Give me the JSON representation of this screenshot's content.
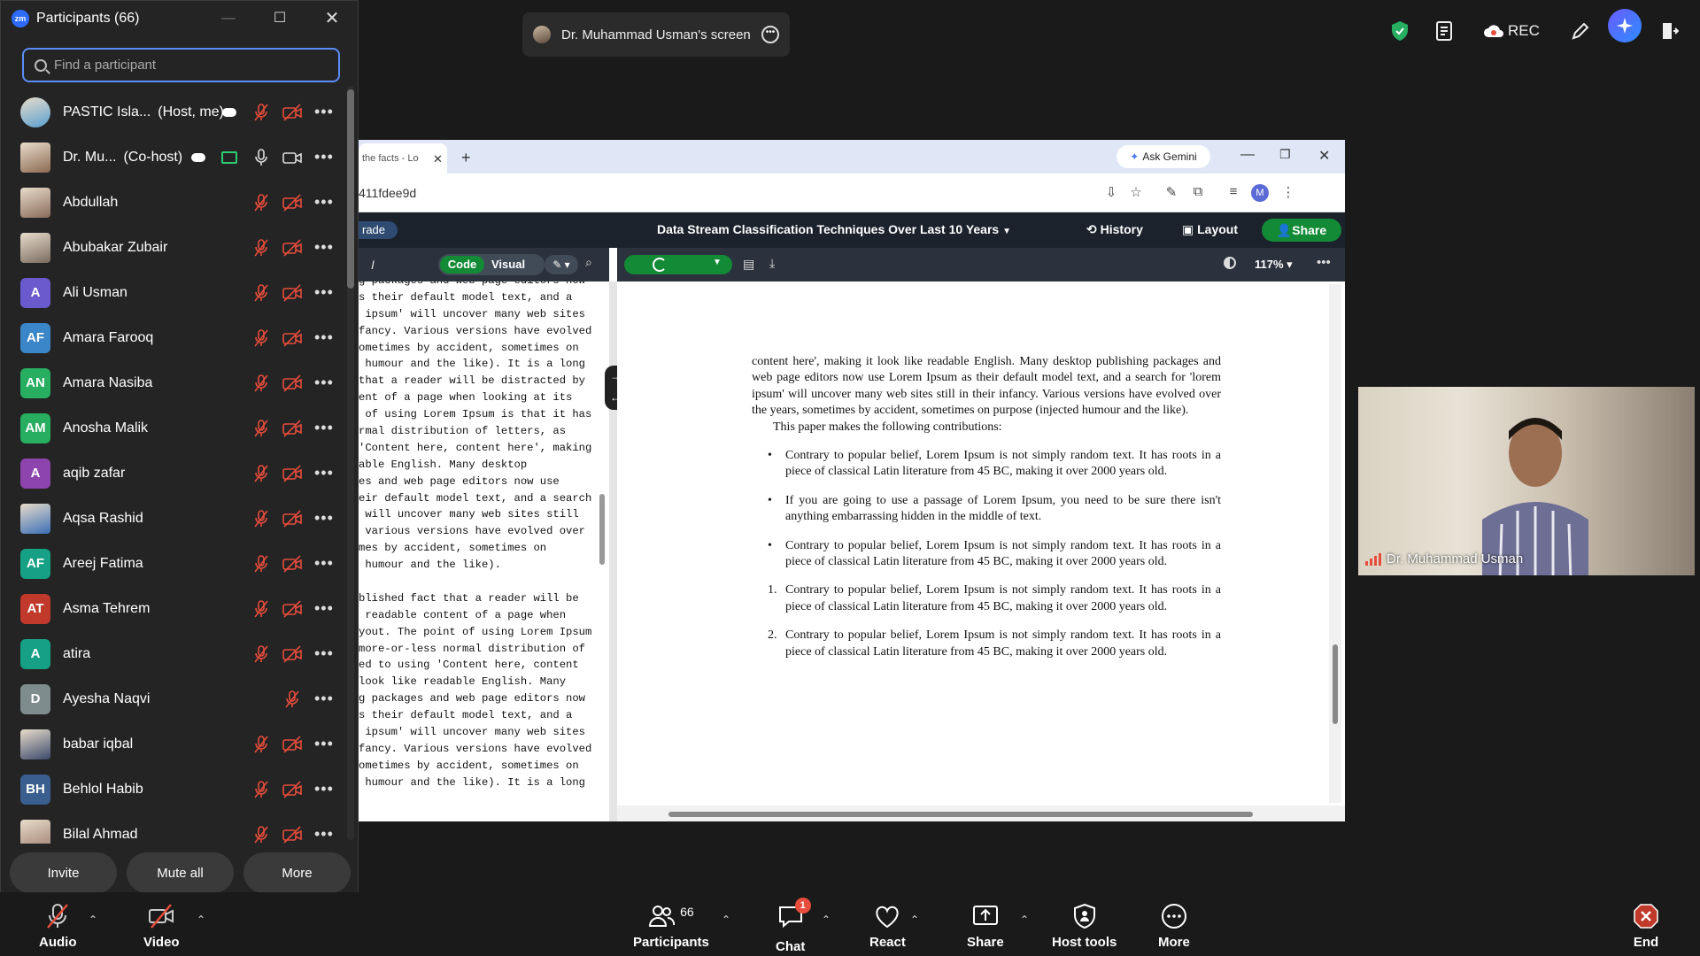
{
  "participants_panel": {
    "logo_text": "zm",
    "title": "Participants (66)",
    "search_placeholder": "Find a participant",
    "participants": [
      {
        "name": "PASTIC Isla...",
        "role": "(Host, me)",
        "avatar": "photo",
        "color": "#5aa0d0"
      },
      {
        "name": "Dr. Mu...",
        "role": "(Co-host)",
        "avatar": "photo",
        "color": "#8c6a52"
      },
      {
        "name": "Abdullah",
        "role": "",
        "avatar": "photo",
        "color": "#8a6b5a"
      },
      {
        "name": "Abubakar Zubair",
        "role": "",
        "avatar": "photo",
        "color": "#7b6b60"
      },
      {
        "name": "Ali Usman",
        "role": "",
        "avatar": "A",
        "color": "#6a5acd"
      },
      {
        "name": "Amara Farooq",
        "role": "",
        "avatar": "AF",
        "color": "#3a86c8"
      },
      {
        "name": "Amara Nasiba",
        "role": "",
        "avatar": "AN",
        "color": "#27ae60"
      },
      {
        "name": "Anosha Malik",
        "role": "",
        "avatar": "AM",
        "color": "#27ae60"
      },
      {
        "name": "aqib zafar",
        "role": "",
        "avatar": "A",
        "color": "#8e44ad"
      },
      {
        "name": "Aqsa Rashid",
        "role": "",
        "avatar": "photo",
        "color": "#3b6fb6"
      },
      {
        "name": "Areej Fatima",
        "role": "",
        "avatar": "AF",
        "color": "#16a085"
      },
      {
        "name": "Asma Tehrem",
        "role": "",
        "avatar": "AT",
        "color": "#c0392b"
      },
      {
        "name": "atira",
        "role": "",
        "avatar": "A",
        "color": "#16a085"
      },
      {
        "name": "Ayesha Naqvi",
        "role": "",
        "avatar": "D",
        "color": "#7f8c8d"
      },
      {
        "name": "babar iqbal",
        "role": "",
        "avatar": "photo",
        "color": "#3b4a6b"
      },
      {
        "name": "Behlol Habib",
        "role": "",
        "avatar": "BH",
        "color": "#3a5f8f"
      },
      {
        "name": "Bilal Ahmad",
        "role": "",
        "avatar": "photo",
        "color": "#a08070"
      }
    ],
    "buttons": {
      "invite": "Invite",
      "mute_all": "Mute all",
      "more": "More"
    }
  },
  "share_tab": {
    "label": "Dr. Muhammad Usman's screen"
  },
  "top_right": {
    "rec_label": "REC"
  },
  "browser": {
    "tab_title": "the facts - Lo",
    "ask_gemini": "Ask Gemini",
    "url": "411fdee9d",
    "profile_initial": "M",
    "overleaf": {
      "left_label": "rade",
      "doc_title": "Data Stream Classification Techniques Over Last 10 Years",
      "history": "History",
      "layout": "Layout",
      "share": "Share"
    },
    "editor": {
      "code_label": "Code",
      "visual_label": "Visual",
      "lines": [
        "g packages and web page editors now",
        "s their default model text, and a",
        " ipsum' will uncover many web sites",
        "fancy. Various versions have evolved",
        "ometimes by accident, sometimes on",
        " humour and the like). It is a long",
        "that a reader will be distracted by",
        "ent of a page when looking at its",
        " of using Lorem Ipsum is that it has",
        "rmal distribution of letters, as",
        "'Content here, content here', making",
        "able English. Many desktop",
        "es and web page editors now use",
        "eir default model text, and a search",
        " will uncover many web sites still",
        " various versions have evolved over",
        "mes by accident, sometimes on",
        " humour and the like).",
        "",
        "blished fact that a reader will be",
        " readable content of a page when",
        "yout. The point of using Lorem Ipsum",
        "more-or-less normal distribution of",
        "ed to using 'Content here, content",
        "look like readable English. Many",
        "g packages and web page editors now",
        "s their default model text, and a",
        " ipsum' will uncover many web sites",
        "fancy. Various versions have evolved",
        "ometimes by accident, sometimes on",
        " humour and the like). It is a long"
      ]
    },
    "pdf": {
      "zoom": "117%",
      "paragraph": "content here', making it look like readable English. Many desktop publishing packages and web page editors now use Lorem Ipsum as their default model text, and a search for 'lorem ipsum' will uncover many web sites still in their infancy. Various versions have evolved over the years, sometimes by accident, sometimes on purpose (injected humour and the like).",
      "contrib_intro": "This paper makes the following contributions:",
      "bullets": [
        "Contrary to popular belief, Lorem Ipsum is not simply random text. It has roots in a piece of classical Latin literature from 45 BC, making it over 2000 years old.",
        "If you are going to use a passage of Lorem Ipsum, you need to be sure there isn't anything embarrassing hidden in the middle of text.",
        "Contrary to popular belief, Lorem Ipsum is not simply random text. It has roots in a piece of classical Latin literature from 45 BC, making it over 2000 years old."
      ],
      "numbered": [
        {
          "marker": "1.",
          "text": "Contrary to popular belief, Lorem Ipsum is not simply random text. It has roots in a piece of classical Latin literature from 45 BC, making it over 2000 years old."
        },
        {
          "marker": "2.",
          "text": "Contrary to popular belief, Lorem Ipsum is not simply random text. It has roots in a piece of classical Latin literature from 45 BC, making it over 2000 years old."
        }
      ]
    }
  },
  "video_tile": {
    "name": "Dr. Muhammad Usman"
  },
  "bottom_bar": {
    "audio": "Audio",
    "video": "Video",
    "participants": "Participants",
    "participants_count": "66",
    "chat": "Chat",
    "chat_badge": "1",
    "react": "React",
    "share": "Share",
    "host_tools": "Host tools",
    "more": "More",
    "end": "End"
  },
  "colors": {
    "accent": "#5b8ef7",
    "overleaf_green": "#138a36",
    "mute_red": "#e74c3c",
    "end_red": "#e74c3c"
  }
}
